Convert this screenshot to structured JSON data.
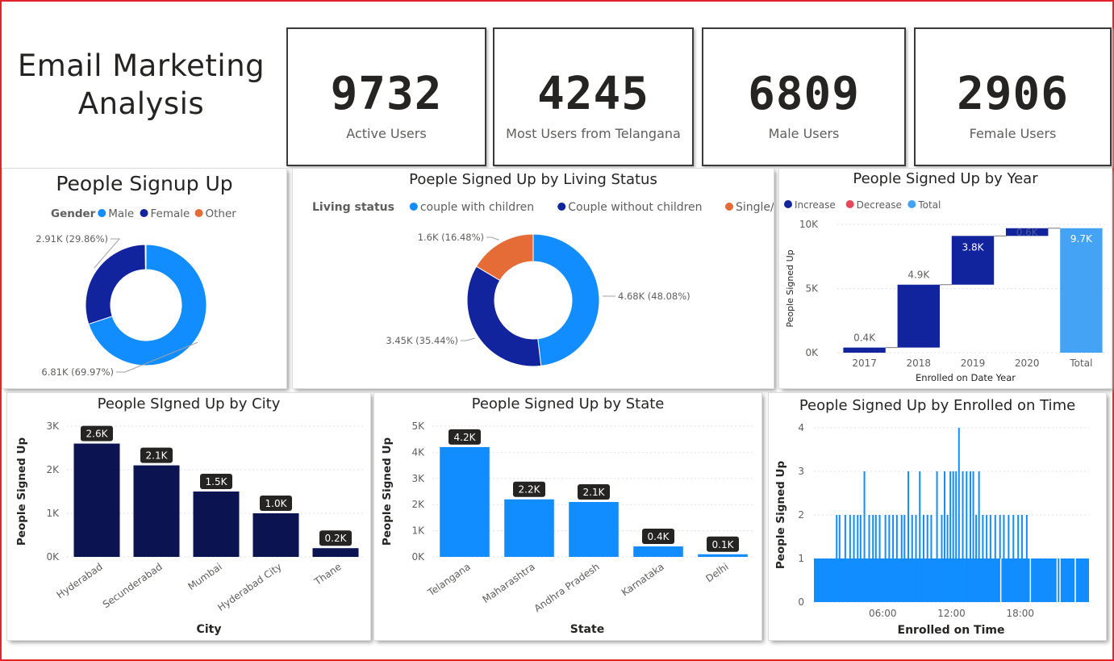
{
  "title_line1": "Email Marketing",
  "title_line2": "Analysis",
  "kpis": [
    {
      "value": "9732",
      "label": "Active Users"
    },
    {
      "value": "4245",
      "label": "Most Users from Telangana"
    },
    {
      "value": "6809",
      "label": "Male Users"
    },
    {
      "value": "2906",
      "label": "Female Users"
    }
  ],
  "gender": {
    "title": "People Signup Up",
    "legend_title": "Gender",
    "legend": [
      {
        "name": "Male",
        "color": "#118dff"
      },
      {
        "name": "Female",
        "color": "#12239e"
      },
      {
        "name": "Other",
        "color": "#e66c37"
      }
    ],
    "chart_data": {
      "type": "pie",
      "slices": [
        {
          "name": "Male",
          "value": 6.81,
          "label": "6.81K (69.97%)",
          "color": "#118dff"
        },
        {
          "name": "Female",
          "value": 2.91,
          "label": "2.91K (29.86%)",
          "color": "#12239e"
        },
        {
          "name": "Other",
          "value": 0.02,
          "color": "#e66c37"
        }
      ]
    }
  },
  "living": {
    "title": "Poeple Signed Up by Living Status",
    "legend_title": "Living status",
    "legend": [
      {
        "name": "couple with children",
        "color": "#118dff"
      },
      {
        "name": "Couple without children",
        "color": "#12239e"
      },
      {
        "name": "Single/living alone",
        "color": "#e66c37"
      }
    ],
    "chart_data": {
      "type": "pie",
      "slices": [
        {
          "name": "couple with children",
          "value": 4.68,
          "label": "4.68K (48.08%)",
          "color": "#118dff"
        },
        {
          "name": "Couple without children",
          "value": 3.45,
          "label": "3.45K (35.44%)",
          "color": "#12239e"
        },
        {
          "name": "Single/living alone",
          "value": 1.6,
          "label": "1.6K (16.48%)",
          "color": "#e66c37"
        }
      ]
    }
  },
  "year": {
    "title": "People Signed Up by Year",
    "legend": [
      {
        "name": "Increase",
        "color": "#12239e"
      },
      {
        "name": "Decrease",
        "color": "#e8485a"
      },
      {
        "name": "Total",
        "color": "#44a3f5"
      }
    ],
    "ylabel": "People Signed Up",
    "xlabel": "Enrolled on Date Year",
    "yticks": [
      "10K",
      "5K",
      "0K"
    ],
    "chart_data": {
      "type": "bar",
      "categories": [
        "2017",
        "2018",
        "2019",
        "2020",
        "Total"
      ],
      "values": [
        0.4,
        4.9,
        3.8,
        0.6,
        9.7
      ],
      "labels": [
        "0.4K",
        "4.9K",
        "3.8K",
        "0.6K",
        "9.7K"
      ],
      "ylim": [
        0,
        10
      ]
    }
  },
  "city": {
    "title": "People SIgned Up by City",
    "ylabel": "People Signed Up",
    "xlabel": "City",
    "yticks": [
      "3K",
      "2K",
      "1K",
      "0K"
    ],
    "chart_data": {
      "type": "bar",
      "categories": [
        "Hyderabad",
        "Secunderabad",
        "Mumbai",
        "Hyderabad City",
        "Thane"
      ],
      "values": [
        2.6,
        2.1,
        1.5,
        1.0,
        0.2
      ],
      "labels": [
        "2.6K",
        "2.1K",
        "1.5K",
        "1.0K",
        "0.2K"
      ],
      "ylim": [
        0,
        3
      ]
    }
  },
  "state": {
    "title": "People Signed Up by State",
    "ylabel": "People Signed Up",
    "xlabel": "State",
    "yticks": [
      "5K",
      "4K",
      "3K",
      "2K",
      "1K",
      "0K"
    ],
    "chart_data": {
      "type": "bar",
      "categories": [
        "Telangana",
        "Maharashtra",
        "Andhra Pradesh",
        "Karnataka",
        "Delhi"
      ],
      "values": [
        4.2,
        2.2,
        2.1,
        0.4,
        0.1
      ],
      "labels": [
        "4.2K",
        "2.2K",
        "2.1K",
        "0.4K",
        "0.1K"
      ],
      "ylim": [
        0,
        5
      ]
    }
  },
  "time": {
    "title": "People Signed Up by Enrolled on Time",
    "ylabel": "People Signed Up",
    "xlabel": "Enrolled on Time",
    "yticks": [
      "4",
      "3",
      "2",
      "1",
      "0"
    ],
    "xticks": [
      "06:00",
      "12:00",
      "18:00"
    ],
    "chart_data": {
      "type": "bar",
      "ylim": [
        0,
        4
      ],
      "x_range": [
        "00:00",
        "24:00"
      ],
      "baseline": 1,
      "spikes": [
        {
          "time": "01:55",
          "value": 2
        },
        {
          "time": "02:10",
          "value": 2
        },
        {
          "time": "02:40",
          "value": 2
        },
        {
          "time": "03:05",
          "value": 2
        },
        {
          "time": "03:25",
          "value": 2
        },
        {
          "time": "03:45",
          "value": 2
        },
        {
          "time": "04:00",
          "value": 2
        },
        {
          "time": "04:20",
          "value": 3
        },
        {
          "time": "04:45",
          "value": 2
        },
        {
          "time": "05:05",
          "value": 2
        },
        {
          "time": "05:20",
          "value": 2
        },
        {
          "time": "05:40",
          "value": 2
        },
        {
          "time": "06:10",
          "value": 2
        },
        {
          "time": "06:30",
          "value": 2
        },
        {
          "time": "06:50",
          "value": 2
        },
        {
          "time": "07:10",
          "value": 2
        },
        {
          "time": "07:35",
          "value": 2
        },
        {
          "time": "07:50",
          "value": 2
        },
        {
          "time": "08:10",
          "value": 3
        },
        {
          "time": "08:30",
          "value": 2
        },
        {
          "time": "08:50",
          "value": 2
        },
        {
          "time": "09:10",
          "value": 3
        },
        {
          "time": "09:30",
          "value": 2
        },
        {
          "time": "09:50",
          "value": 2
        },
        {
          "time": "10:10",
          "value": 2
        },
        {
          "time": "10:40",
          "value": 3
        },
        {
          "time": "11:05",
          "value": 2
        },
        {
          "time": "11:20",
          "value": 3
        },
        {
          "time": "11:35",
          "value": 2
        },
        {
          "time": "11:50",
          "value": 3
        },
        {
          "time": "12:05",
          "value": 3
        },
        {
          "time": "12:20",
          "value": 3
        },
        {
          "time": "12:35",
          "value": 4
        },
        {
          "time": "12:55",
          "value": 3
        },
        {
          "time": "13:15",
          "value": 3
        },
        {
          "time": "13:35",
          "value": 3
        },
        {
          "time": "13:50",
          "value": 3
        },
        {
          "time": "14:05",
          "value": 2
        },
        {
          "time": "14:20",
          "value": 3
        },
        {
          "time": "14:40",
          "value": 2
        },
        {
          "time": "15:00",
          "value": 2
        },
        {
          "time": "15:20",
          "value": 2
        },
        {
          "time": "15:45",
          "value": 2
        },
        {
          "time": "16:10",
          "value": 2
        },
        {
          "time": "16:30",
          "value": 2
        },
        {
          "time": "16:55",
          "value": 2
        },
        {
          "time": "17:20",
          "value": 2
        },
        {
          "time": "17:45",
          "value": 2
        },
        {
          "time": "18:05",
          "value": 2
        },
        {
          "time": "18:30",
          "value": 2
        }
      ],
      "gaps": [
        "16:15",
        "18:50",
        "21:10",
        "21:25",
        "22:45"
      ]
    }
  }
}
